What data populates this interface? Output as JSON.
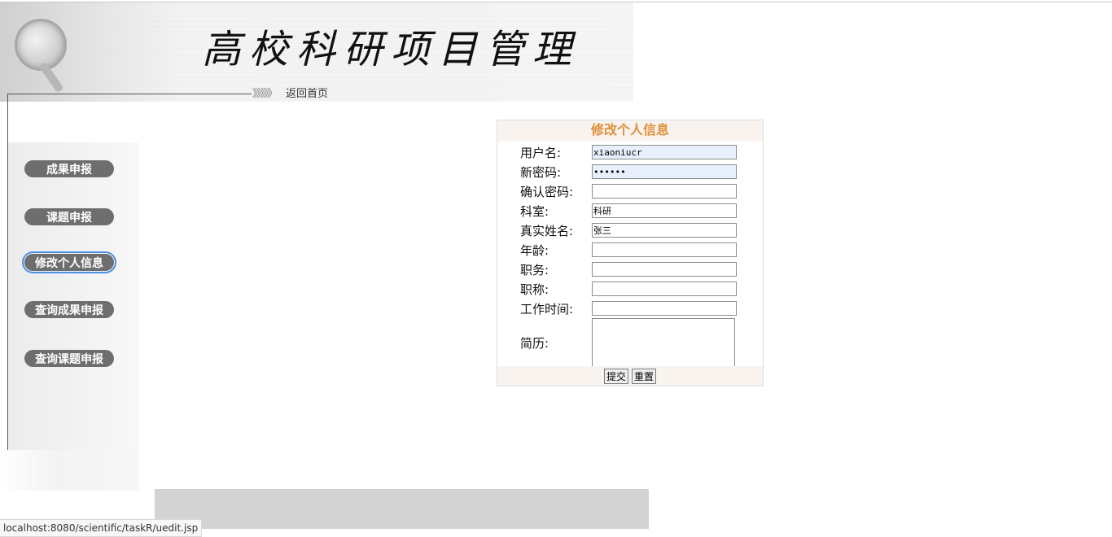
{
  "header": {
    "title": "高校科研项目管理",
    "home_link": "返回首页",
    "chevrons": "》》》》》"
  },
  "sidebar": {
    "items": [
      {
        "label": "成果申报"
      },
      {
        "label": "课题申报"
      },
      {
        "label": "修改个人信息"
      },
      {
        "label": "查询成果申报"
      },
      {
        "label": "查询课题申报"
      }
    ]
  },
  "form": {
    "title": "修改个人信息",
    "fields": [
      {
        "label": "用户名:",
        "value": "xiaoniucr"
      },
      {
        "label": "新密码:",
        "value": "••••••"
      },
      {
        "label": "确认密码:",
        "value": ""
      },
      {
        "label": "科室:",
        "value": "科研"
      },
      {
        "label": "真实姓名:",
        "value": "张三"
      },
      {
        "label": "年龄:",
        "value": ""
      },
      {
        "label": "职务:",
        "value": ""
      },
      {
        "label": "职称:",
        "value": ""
      },
      {
        "label": "工作时间:",
        "value": ""
      },
      {
        "label": "简历:",
        "value": ""
      }
    ],
    "submit_label": "提交",
    "reset_label": "重置"
  },
  "status_bar": {
    "url": "localhost:8080/scientific/taskR/uedit.jsp"
  },
  "colors": {
    "form_title": "#e0903a",
    "nav_button": "#6e6e6e",
    "autofill": "#e8f0fe"
  }
}
